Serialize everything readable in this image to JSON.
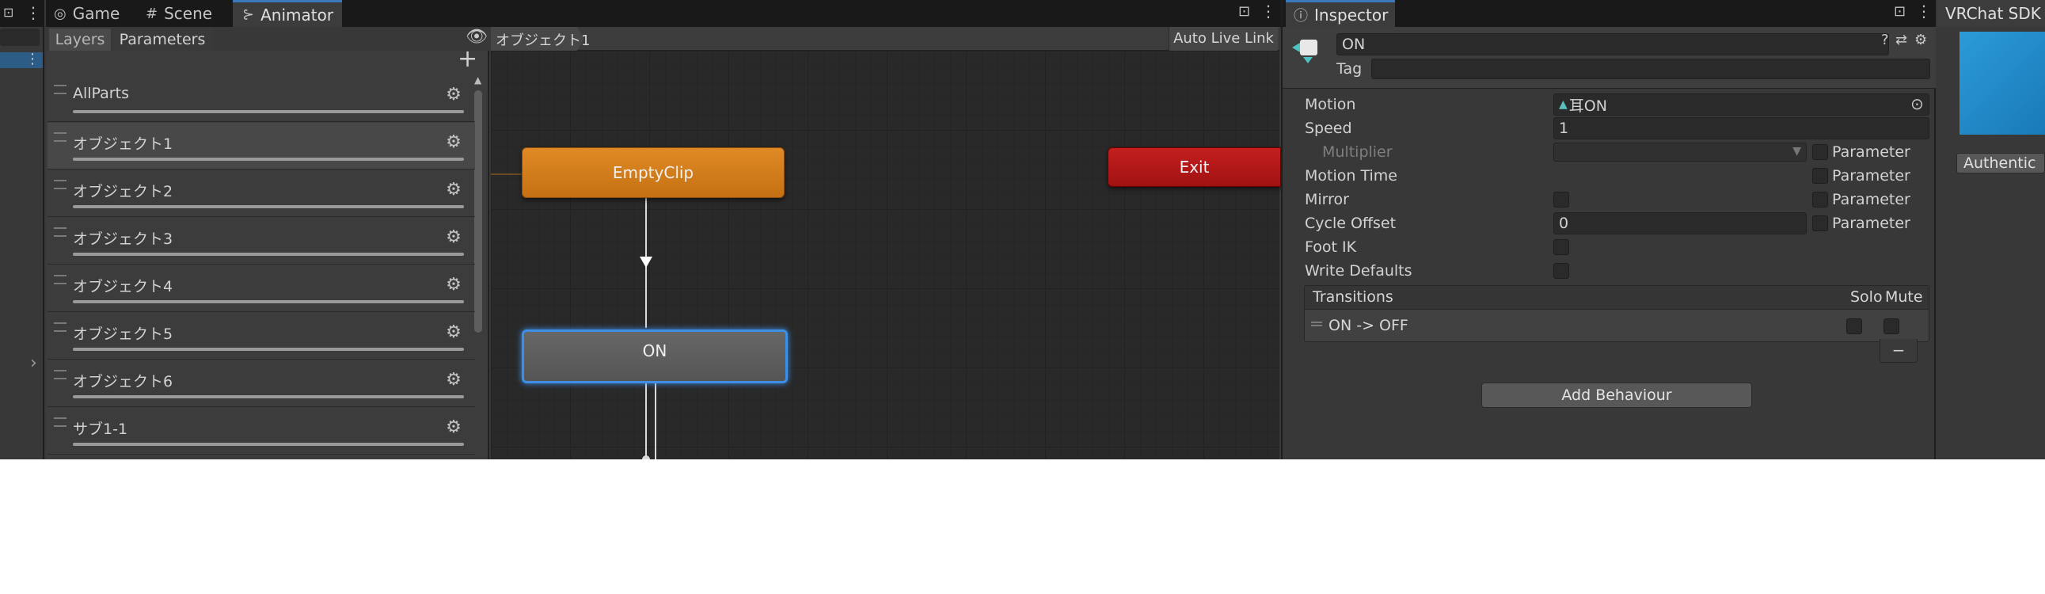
{
  "tabs_left": [
    {
      "label": "Game",
      "icon": "gamepad-icon"
    },
    {
      "label": "Scene",
      "icon": "grid-icon"
    },
    {
      "label": "Animator",
      "icon": "animator-icon"
    }
  ],
  "animator": {
    "subtabs": {
      "layers": "Layers",
      "parameters": "Parameters"
    },
    "breadcrumb": "オブジェクト1",
    "auto_live_link": "Auto Live Link",
    "layers": [
      {
        "name": "AllParts"
      },
      {
        "name": "オブジェクト1"
      },
      {
        "name": "オブジェクト2"
      },
      {
        "name": "オブジェクト3"
      },
      {
        "name": "オブジェクト4"
      },
      {
        "name": "オブジェクト5"
      },
      {
        "name": "オブジェクト6"
      },
      {
        "name": "サブ1-1"
      }
    ],
    "nodes": {
      "empty_clip": "EmptyClip",
      "exit": "Exit",
      "on": "ON"
    }
  },
  "inspector": {
    "tab_label": "Inspector",
    "state_name": "ON",
    "tag_label": "Tag",
    "tag_value": "",
    "motion_label": "Motion",
    "motion_value": "耳ON",
    "speed_label": "Speed",
    "speed_value": "1",
    "multiplier_label": "Multiplier",
    "motion_time_label": "Motion Time",
    "mirror_label": "Mirror",
    "cycle_offset_label": "Cycle Offset",
    "cycle_offset_value": "0",
    "foot_ik_label": "Foot IK",
    "write_defaults_label": "Write Defaults",
    "parameter_label": "Parameter",
    "transitions_header": "Transitions",
    "solo_label": "Solo",
    "mute_label": "Mute",
    "transitions": [
      {
        "label": "ON -> OFF"
      }
    ],
    "minus": "−",
    "add_behaviour": "Add Behaviour"
  },
  "vrchat": {
    "tab_label": "VRChat SDK",
    "auth_button": "Authentic"
  },
  "colors": {
    "empty_clip": "#d2801f",
    "exit": "#b31919",
    "on_node": "#5f5f5f",
    "selection_outline": "#4aa3ff",
    "vrchat_blue": "#1e87c6"
  }
}
